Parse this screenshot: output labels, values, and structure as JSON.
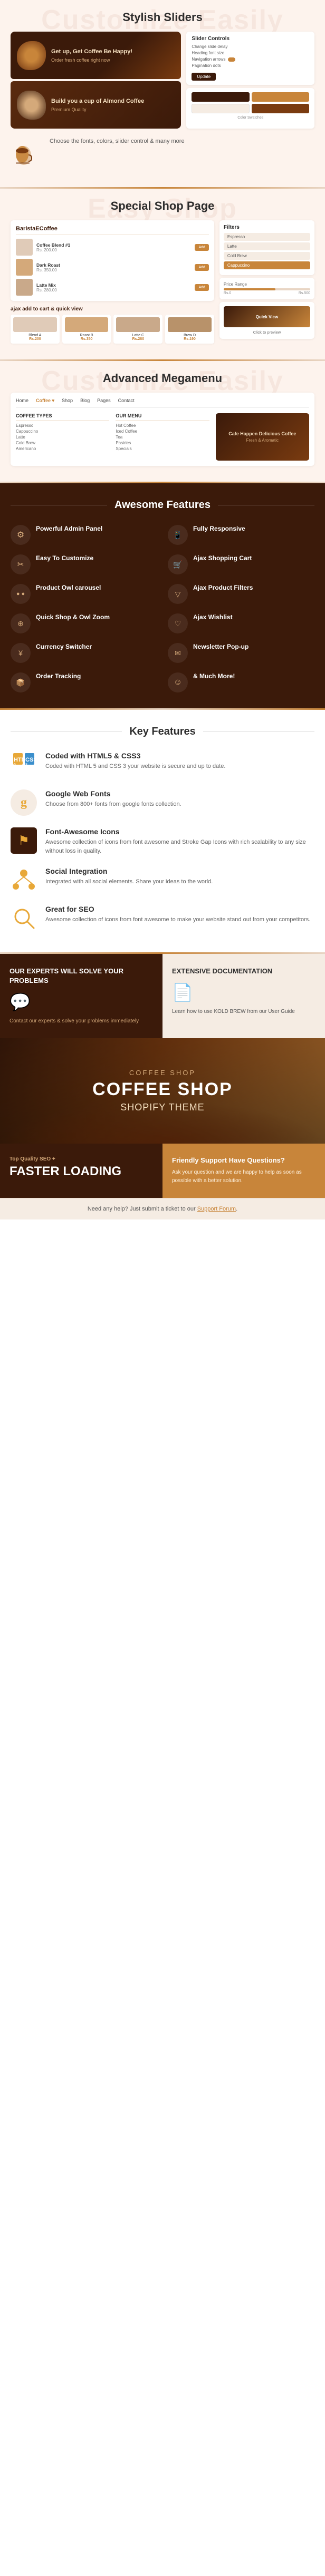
{
  "sections": {
    "stylish_sliders": {
      "watermark": "Customize Easily",
      "title": "Stylish Sliders",
      "slide1": {
        "headline": "Get up, Get Coffee Be Happy!",
        "subtext": "Order fresh coffee right now"
      },
      "slide2": {
        "headline": "Build you a cup of Almond Coffee",
        "subtext": "Premium Quality"
      },
      "controls_card": {
        "title": "Slider Controls",
        "options": [
          "Change slide delay",
          "Heading font size",
          "Navigation arrows",
          "Pagination dots"
        ],
        "button": "Update"
      },
      "description": {
        "label": "Choose the fonts, colors, slider control & many more"
      }
    },
    "easy_shop": {
      "watermark": "Easy Shop",
      "title": "Special Shop Page",
      "ajax_label": "ajax add to cart & quick view",
      "shop_title": "BaristaECoffee",
      "items": [
        {
          "name": "Coffee Blend #1",
          "price": "Rs. 200.00"
        },
        {
          "name": "Dark Roast",
          "price": "Rs. 350.00"
        },
        {
          "name": "Latte Mix",
          "price": "Rs. 280.00"
        }
      ],
      "sidebar_filters": [
        "Espresso",
        "Latte",
        "Cold Brew",
        "Cappuccino"
      ],
      "product_grid": [
        {
          "name": "Blend A",
          "price": "Rs.200"
        },
        {
          "name": "Roast B",
          "price": "Rs.350"
        },
        {
          "name": "Latte C",
          "price": "Rs.280"
        },
        {
          "name": "Brew D",
          "price": "Rs.190"
        }
      ]
    },
    "megamenu": {
      "watermark": "Customize Easily",
      "title": "Advanced Megamenu",
      "nav_items": [
        "Home",
        "Coffee",
        "Shop",
        "Blog",
        "Pages",
        "Contact"
      ],
      "col1": {
        "title": "COFFEE TYPES",
        "links": [
          "Espresso",
          "Cappuccino",
          "Latte",
          "Cold Brew",
          "Americano"
        ]
      },
      "col2": {
        "title": "OUR MENU",
        "links": [
          "Hot Coffee",
          "Iced Coffee",
          "Tea",
          "Pastries",
          "Specials"
        ]
      },
      "col3": {
        "label": "Cafe Happen Delicious Coffee",
        "subtext": "Fresh & Aromatic"
      }
    },
    "awesome_features": {
      "title": "Awesome Features",
      "items": [
        {
          "icon": "⚙",
          "title": "Powerful Admin Panel",
          "desc": ""
        },
        {
          "icon": "↩",
          "title": "Fully Responsive",
          "desc": ""
        },
        {
          "icon": "✂",
          "title": "Easy To Customize",
          "desc": ""
        },
        {
          "icon": "🛒",
          "title": "Ajax Shopping Cart",
          "desc": ""
        },
        {
          "icon": "●●●",
          "title": "Product Owl carousel",
          "desc": ""
        },
        {
          "icon": "▽",
          "title": "Ajax Product Filters",
          "desc": ""
        },
        {
          "icon": "⊕",
          "title": "Quick Shop & Owl Zoom",
          "desc": ""
        },
        {
          "icon": "♡",
          "title": "Ajax Wishlist",
          "desc": ""
        },
        {
          "icon": "¥",
          "title": "Currency Switcher",
          "desc": ""
        },
        {
          "icon": "✉",
          "title": "Newsletter Pop-up",
          "desc": ""
        },
        {
          "icon": "📦",
          "title": "Order Tracking",
          "desc": ""
        },
        {
          "icon": "☺",
          "title": "& Much More!",
          "desc": ""
        }
      ]
    },
    "key_features": {
      "title": "Key Features",
      "items": [
        {
          "icon": "🖥",
          "icon_color": "#e8a838",
          "title": "Coded with HTML5 & CSS3",
          "desc": "Coded with HTML 5 and CSS 3 your website is secure and up to date."
        },
        {
          "icon": "g",
          "icon_color": "#e8a838",
          "title": "Google Web Fonts",
          "desc": "Choose from 800+ fonts from google fonts collection."
        },
        {
          "icon": "⚑",
          "icon_color": "#e8a838",
          "title": "Font-Awesome Icons",
          "desc": "Awesome collection of icons from font awesome and Stroke Gap Icons with rich scalability to any size without loss in quality."
        },
        {
          "icon": "↔",
          "icon_color": "#e8a838",
          "title": "Social Integration",
          "desc": "Integrated with all social elements. Share your ideas to the world."
        },
        {
          "icon": "🔍",
          "icon_color": "#e8a838",
          "title": "Great for SEO",
          "desc": "Awesome collection of icons from font awesome to make your website stand out from your competitors."
        }
      ]
    },
    "experts": {
      "heading": "OUR EXPERTS WILL solve your problems",
      "chat_icon": "💬",
      "text": "Contact our experts & solve your problems immediately"
    },
    "documentation": {
      "heading": "EXTENSIVE Documentation",
      "doc_icon": "📄",
      "text": "Learn how to use KOLD BREW from our User Guide"
    },
    "coffee_shop_banner": {
      "pretitle": "COFFEE SHOP",
      "main_title": "COFFEE SHOP",
      "subtitle": "Shopify Theme"
    },
    "seo": {
      "pretitle": "Top Quality SEO +",
      "title": "FASTER LOADING"
    },
    "support": {
      "title": "Friendly Support Have Questions?",
      "text": "Ask your question and we are happy to help as soon as possible with a better solution."
    },
    "footer": {
      "text": "Need any help? Just submit a ticket to our Support Forum."
    }
  }
}
